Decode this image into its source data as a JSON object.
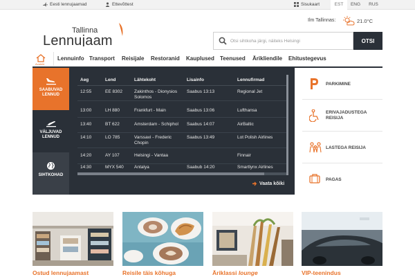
{
  "topbar": {
    "airports_link": "Eesti lennujaamad",
    "business_link": "Ettevõttest",
    "sitemap_link": "Sisukaart",
    "languages": [
      "EST",
      "ENG",
      "RUS"
    ],
    "active_language": "EST"
  },
  "logo": {
    "line1": "Tallinna",
    "line2": "Lennujaam"
  },
  "weather": {
    "label": "Ilm Tallinnas:",
    "temperature": "21.0°C",
    "icon": "sun-cloud-icon"
  },
  "search": {
    "placeholder": "Otsi sihtkoha järgi, näiteks Helsingi",
    "button": "OTSI"
  },
  "nav": {
    "home_label": "Avaleht",
    "items": [
      "Lennuinfo",
      "Transport",
      "Reisijale",
      "Restoranid",
      "Kauplused",
      "Teenused",
      "Ärikliendile",
      "Ehitustegevus"
    ]
  },
  "flight_tabs": [
    {
      "label": "SAABUVAD LENNUD",
      "icon": "plane-landing-icon",
      "active": true
    },
    {
      "label": "VÄLJUVAD LENNUD",
      "icon": "plane-takeoff-icon",
      "active": false
    },
    {
      "label": "SIHTKOHAD",
      "icon": "globe-icon",
      "active": false
    }
  ],
  "flights": {
    "headers": [
      "Aeg",
      "Lend",
      "Lähtekoht",
      "Lisainfo",
      "Lennufirmad"
    ],
    "rows": [
      {
        "time": "12:55",
        "flight": "EE 8302",
        "origin": "Zakinthos - Dionysios Solomos",
        "info": "Saabus 13:13",
        "airline": "Regional Jet"
      },
      {
        "time": "13:00",
        "flight": "LH 880",
        "origin": "Frankfurt - Main",
        "info": "Saabus 13:06",
        "airline": "Lufthansa"
      },
      {
        "time": "13:40",
        "flight": "BT 622",
        "origin": "Amsterdam - Schiphol",
        "info": "Saabus 14:07",
        "airline": "AirBaltic"
      },
      {
        "time": "14:10",
        "flight": "LO 785",
        "origin": "Varssavi - Frederic Chopin",
        "info": "Saabus 13:49",
        "airline": "Lot Polish Airlines"
      },
      {
        "time": "14:20",
        "flight": "AY 107",
        "origin": "Helsingi - Vantaa",
        "info": "",
        "airline": "Finnair"
      },
      {
        "time": "14:30",
        "flight": "MYX 540",
        "origin": "Antalya",
        "info": "Saabub 14:20",
        "airline": "Smartlynx Airlines"
      }
    ],
    "view_all": "Vaata kõiki"
  },
  "services": [
    {
      "label": "PARKIMINE",
      "icon": "parking-icon"
    },
    {
      "label": "ERIVAJADUSTEGA REISIJA",
      "icon": "wheelchair-icon"
    },
    {
      "label": "LASTEGA REISIJA",
      "icon": "family-icon"
    },
    {
      "label": "PAGAS",
      "icon": "luggage-icon"
    }
  ],
  "cards": [
    {
      "title": "Ostud lennujaamast",
      "title_em": ""
    },
    {
      "title": "Reisile täis kõhuga",
      "title_em": ""
    },
    {
      "title": "Äriklassi ",
      "title_em": "lounge"
    },
    {
      "title": "VIP-teenindus",
      "title_em": ""
    }
  ],
  "colors": {
    "accent": "#e8732b",
    "dark_panel": "#2a3038"
  }
}
